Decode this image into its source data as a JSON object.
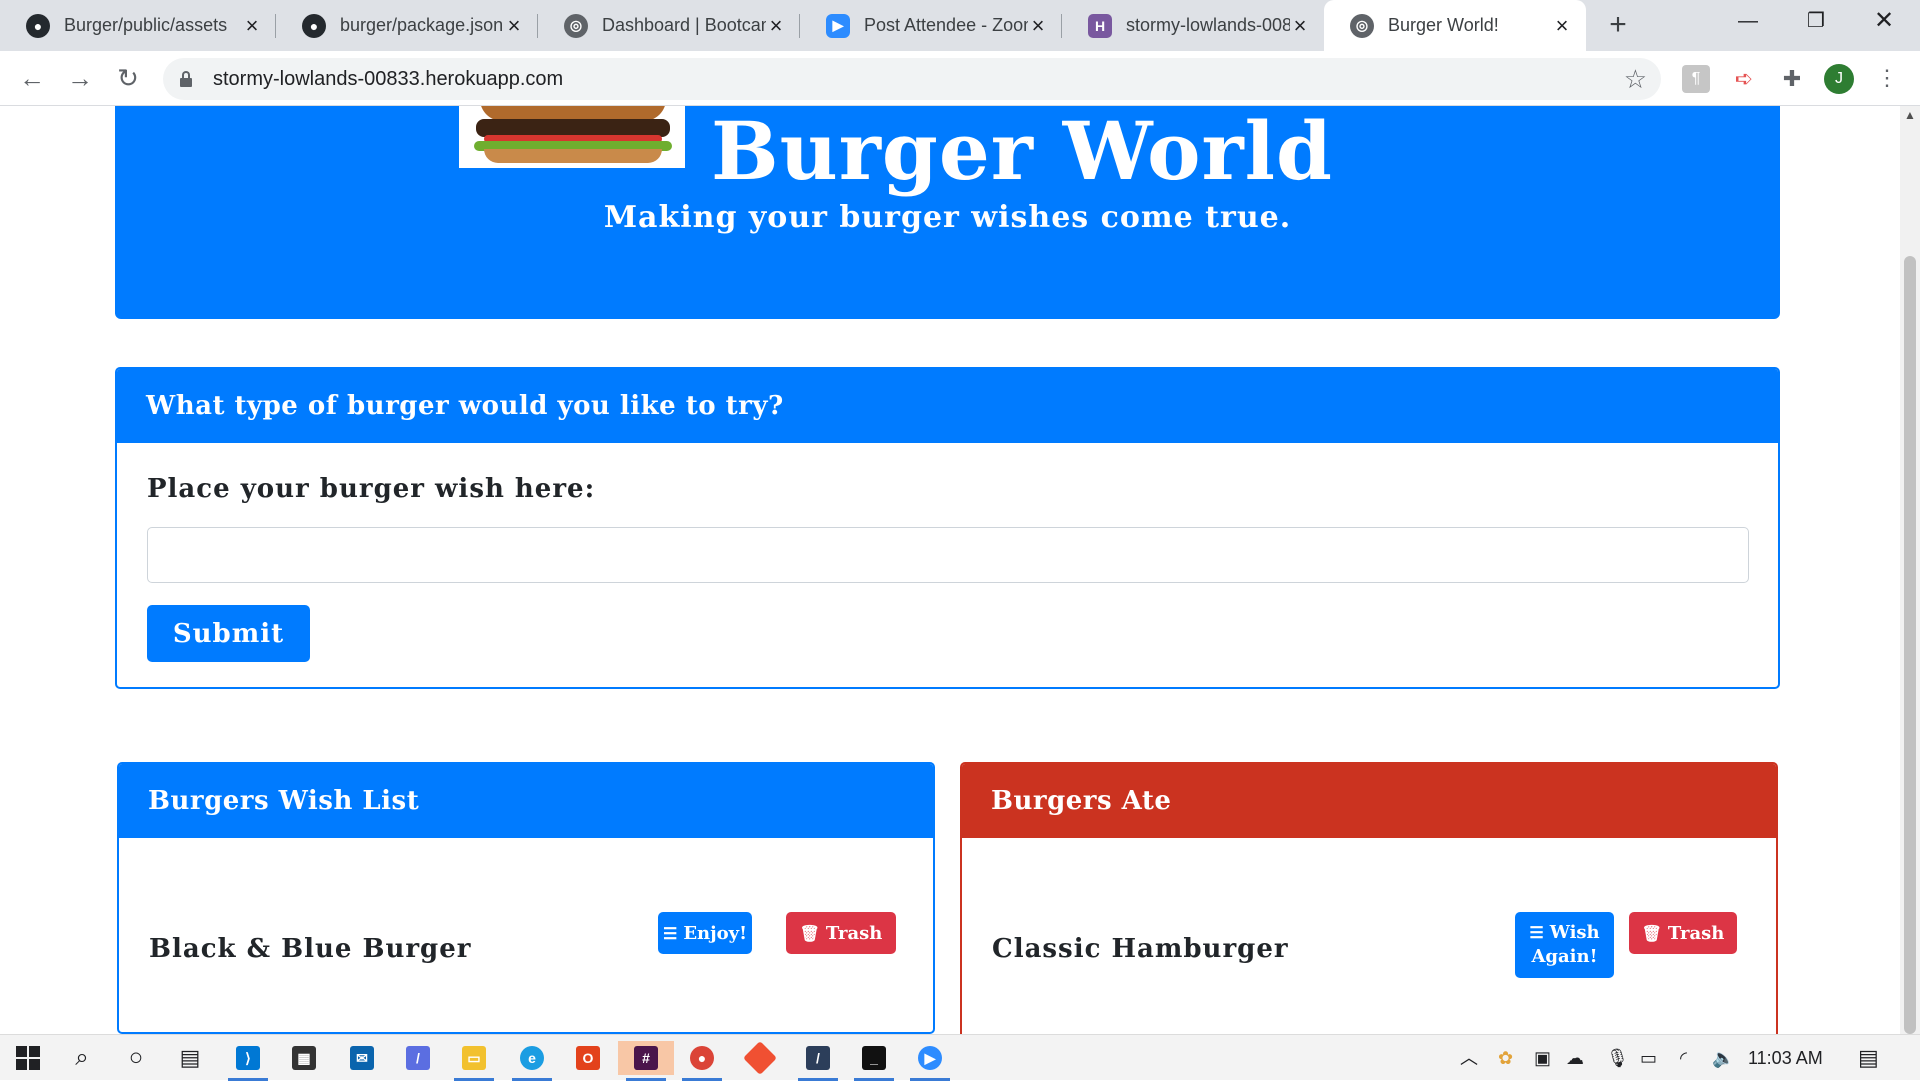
{
  "browser": {
    "tabs": [
      {
        "title": "Burger/public/assets",
        "favicon": "github-icon"
      },
      {
        "title": "burger/package.json",
        "favicon": "github-icon"
      },
      {
        "title": "Dashboard | Bootcam",
        "favicon": "globe-icon"
      },
      {
        "title": "Post Attendee - Zoom",
        "favicon": "zoom-icon"
      },
      {
        "title": "stormy-lowlands-008",
        "favicon": "heroku-icon"
      },
      {
        "title": "Burger World!",
        "favicon": "globe-icon"
      }
    ],
    "active_tab": 5,
    "url": "stormy-lowlands-00833.herokuapp.com",
    "profile_initial": "J"
  },
  "page": {
    "site_title": "Burger World",
    "tagline": "Making your burger wishes come true.",
    "form": {
      "header": "What type of burger would you like to try?",
      "label": "Place your burger wish here:",
      "input_value": "",
      "submit_label": "Submit"
    },
    "wish_list": {
      "header": "Burgers Wish List",
      "items": [
        {
          "name": "Black & Blue Burger",
          "primary_action": "Enjoy!",
          "secondary_action": "Trash"
        }
      ]
    },
    "ate_list": {
      "header": "Burgers Ate",
      "items": [
        {
          "name": "Classic Hamburger",
          "primary_action_line1": "Wish",
          "primary_action_line2": "Again!",
          "secondary_action": "Trash"
        }
      ]
    }
  },
  "colors": {
    "primary": "#007bff",
    "danger": "#dc3545",
    "ate_header": "#cb3320"
  },
  "taskbar": {
    "clock": "11:03 AM"
  }
}
